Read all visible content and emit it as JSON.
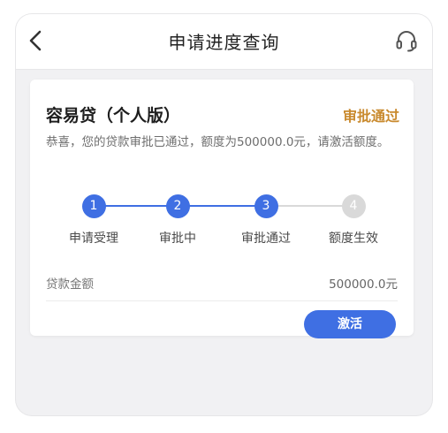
{
  "header": {
    "title": "申请进度查询"
  },
  "card": {
    "product_name": "容易贷（个人版）",
    "status": "审批通过",
    "message": "恭喜，您的贷款审批已通过，额度为500000.0元，请激活额度。",
    "steps": [
      {
        "number": "1",
        "label": "申请受理",
        "state": "done"
      },
      {
        "number": "2",
        "label": "审批中",
        "state": "done"
      },
      {
        "number": "3",
        "label": "审批通过",
        "state": "done"
      },
      {
        "number": "4",
        "label": "额度生效",
        "state": "pending"
      }
    ],
    "amount_label": "贷款金额",
    "amount_value": "500000.0元",
    "activate_label": "激活"
  },
  "colors": {
    "accent": "#3f6fe3",
    "status": "#c98a2e",
    "pending": "#d9d9d9"
  },
  "icons": {
    "back": "chevron-left-icon",
    "service": "headset-icon"
  }
}
